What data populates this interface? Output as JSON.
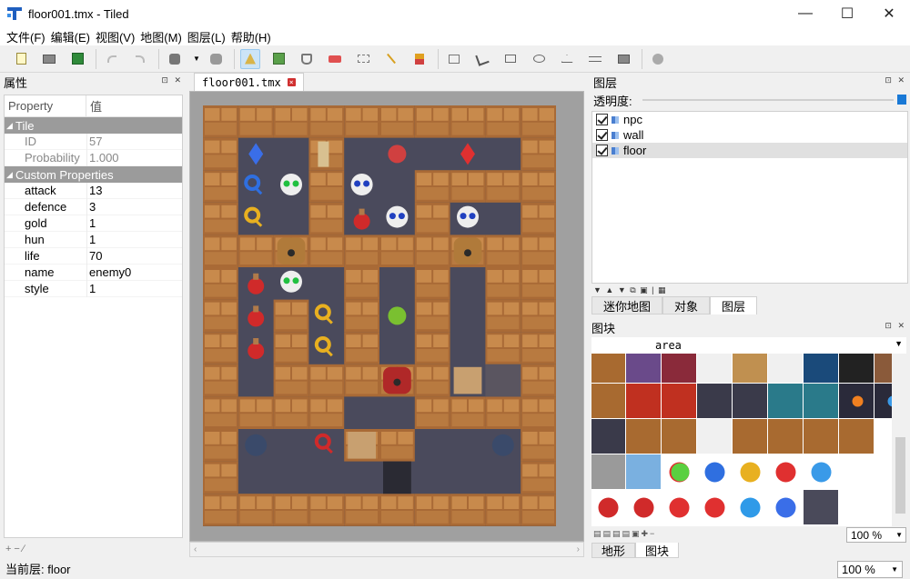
{
  "window": {
    "title": "floor001.tmx - Tiled",
    "min": "—",
    "max": "☐",
    "close": "✕"
  },
  "menu": [
    "文件(F)",
    "编辑(E)",
    "视图(V)",
    "地图(M)",
    "图层(L)",
    "帮助(H)"
  ],
  "properties": {
    "title": "属性",
    "col_property": "Property",
    "col_value": "值",
    "group_tile": "Tile",
    "tile_rows": [
      {
        "k": "ID",
        "v": "57"
      },
      {
        "k": "Probability",
        "v": "1.000"
      }
    ],
    "group_custom": "Custom Properties",
    "custom_rows": [
      {
        "k": "attack",
        "v": "13"
      },
      {
        "k": "defence",
        "v": "3"
      },
      {
        "k": "gold",
        "v": "1"
      },
      {
        "k": "hun",
        "v": "1"
      },
      {
        "k": "life",
        "v": "70"
      },
      {
        "k": "name",
        "v": "enemy0"
      },
      {
        "k": "style",
        "v": "1"
      }
    ]
  },
  "document_tab": "floor001.tmx",
  "layers": {
    "title": "图层",
    "opacity_label": "透明度:",
    "opacity_value": 1.0,
    "items": [
      "npc",
      "wall",
      "floor"
    ],
    "selected": "floor"
  },
  "right_tabs": [
    "迷你地图",
    "对象",
    "图层"
  ],
  "right_tab_active": "图层",
  "tiles": {
    "title": "图块",
    "tileset_name": "area",
    "zoom": "100 %"
  },
  "bottom_tabs": [
    "地形",
    "图块"
  ],
  "bottom_tab_active": "图块",
  "status": {
    "current_layer": "当前层: floor",
    "zoom": "100 %"
  },
  "colors": {
    "accent": "#1979d6",
    "wall": "#b5733c",
    "floor": "#4a4a5c",
    "selected_tool": "#cce4f7"
  }
}
